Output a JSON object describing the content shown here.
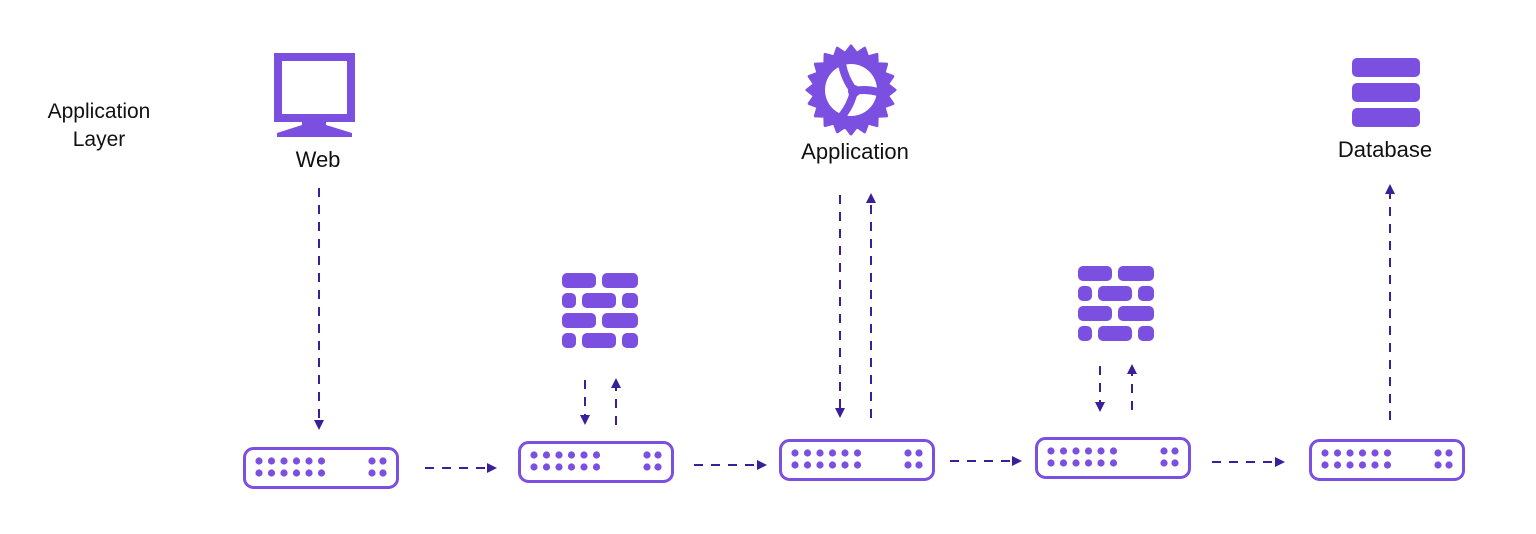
{
  "layer": {
    "label_line1": "Application",
    "label_line2": "Layer"
  },
  "colors": {
    "accent": "#7b4fe0",
    "arrow": "#3a1f9a",
    "text": "#111111"
  },
  "nodes": {
    "web": {
      "label": "Web",
      "icon": "monitor-icon"
    },
    "application": {
      "label": "Application",
      "icon": "gear-icon"
    },
    "database": {
      "label": "Database",
      "icon": "database-icon"
    },
    "firewall_1": {
      "icon": "firewall-icon"
    },
    "firewall_2": {
      "icon": "firewall-icon"
    },
    "switches": [
      {
        "id": "switch-1",
        "icon": "network-switch-icon"
      },
      {
        "id": "switch-2",
        "icon": "network-switch-icon"
      },
      {
        "id": "switch-3",
        "icon": "network-switch-icon"
      },
      {
        "id": "switch-4",
        "icon": "network-switch-icon"
      },
      {
        "id": "switch-5",
        "icon": "network-switch-icon"
      }
    ]
  },
  "edges": [
    {
      "from": "web",
      "to": "switch-1",
      "style": "dashed"
    },
    {
      "from": "switch-1",
      "to": "switch-2",
      "style": "dashed"
    },
    {
      "from": "switch-2",
      "to": "firewall-1",
      "style": "dashed"
    },
    {
      "from": "firewall-1",
      "to": "switch-2",
      "style": "dashed"
    },
    {
      "from": "switch-2",
      "to": "switch-3",
      "style": "dashed"
    },
    {
      "from": "application",
      "to": "switch-3",
      "style": "dashed"
    },
    {
      "from": "switch-3",
      "to": "application",
      "style": "dashed"
    },
    {
      "from": "switch-3",
      "to": "switch-4",
      "style": "dashed"
    },
    {
      "from": "switch-4",
      "to": "firewall-2",
      "style": "dashed"
    },
    {
      "from": "firewall-2",
      "to": "switch-4",
      "style": "dashed"
    },
    {
      "from": "switch-4",
      "to": "switch-5",
      "style": "dashed"
    },
    {
      "from": "switch-5",
      "to": "database",
      "style": "dashed"
    }
  ]
}
